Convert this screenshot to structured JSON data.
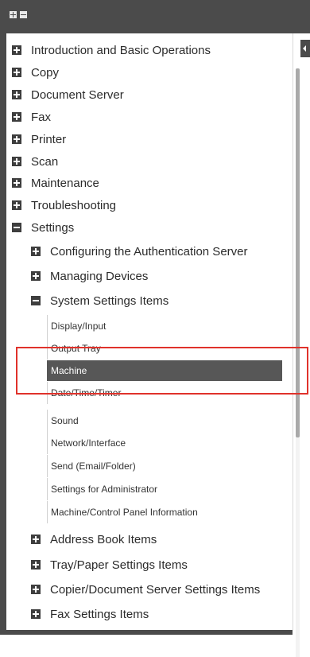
{
  "toolbar": {
    "expand_all_icon": "plus-box-icon",
    "collapse_all_icon": "minus-box-icon"
  },
  "tree": {
    "top_items": [
      {
        "label": "Introduction and Basic Operations",
        "state": "collapsed"
      },
      {
        "label": "Copy",
        "state": "collapsed"
      },
      {
        "label": "Document Server",
        "state": "collapsed"
      },
      {
        "label": "Fax",
        "state": "collapsed"
      },
      {
        "label": "Printer",
        "state": "collapsed"
      },
      {
        "label": "Scan",
        "state": "collapsed"
      },
      {
        "label": "Maintenance",
        "state": "collapsed"
      },
      {
        "label": "Troubleshooting",
        "state": "collapsed"
      },
      {
        "label": "Settings",
        "state": "expanded"
      }
    ],
    "settings_children": [
      {
        "label": "Configuring the Authentication Server",
        "state": "collapsed"
      },
      {
        "label": "Managing Devices",
        "state": "collapsed"
      },
      {
        "label": "System Settings Items",
        "state": "expanded"
      }
    ],
    "system_settings_leaves": [
      {
        "label": "Display/Input"
      },
      {
        "label": "Output Tray"
      },
      {
        "label": "Machine",
        "selected": true
      },
      {
        "label": "Date/Time/Timer"
      },
      {
        "label": "Sound"
      },
      {
        "label": "Network/Interface"
      },
      {
        "label": "Send (Email/Folder)"
      },
      {
        "label": "Settings for Administrator"
      },
      {
        "label": "Machine/Control Panel Information"
      }
    ],
    "after_children": [
      {
        "label": "Address Book Items",
        "state": "collapsed"
      },
      {
        "label": "Tray/Paper Settings Items",
        "state": "collapsed"
      },
      {
        "label": "Copier/Document Server Settings Items",
        "state": "collapsed"
      },
      {
        "label": "Fax Settings Items",
        "state": "collapsed"
      }
    ]
  },
  "colors": {
    "frame": "#4b4b4b",
    "selected_bg": "#575757",
    "highlight": "#e0322b"
  }
}
